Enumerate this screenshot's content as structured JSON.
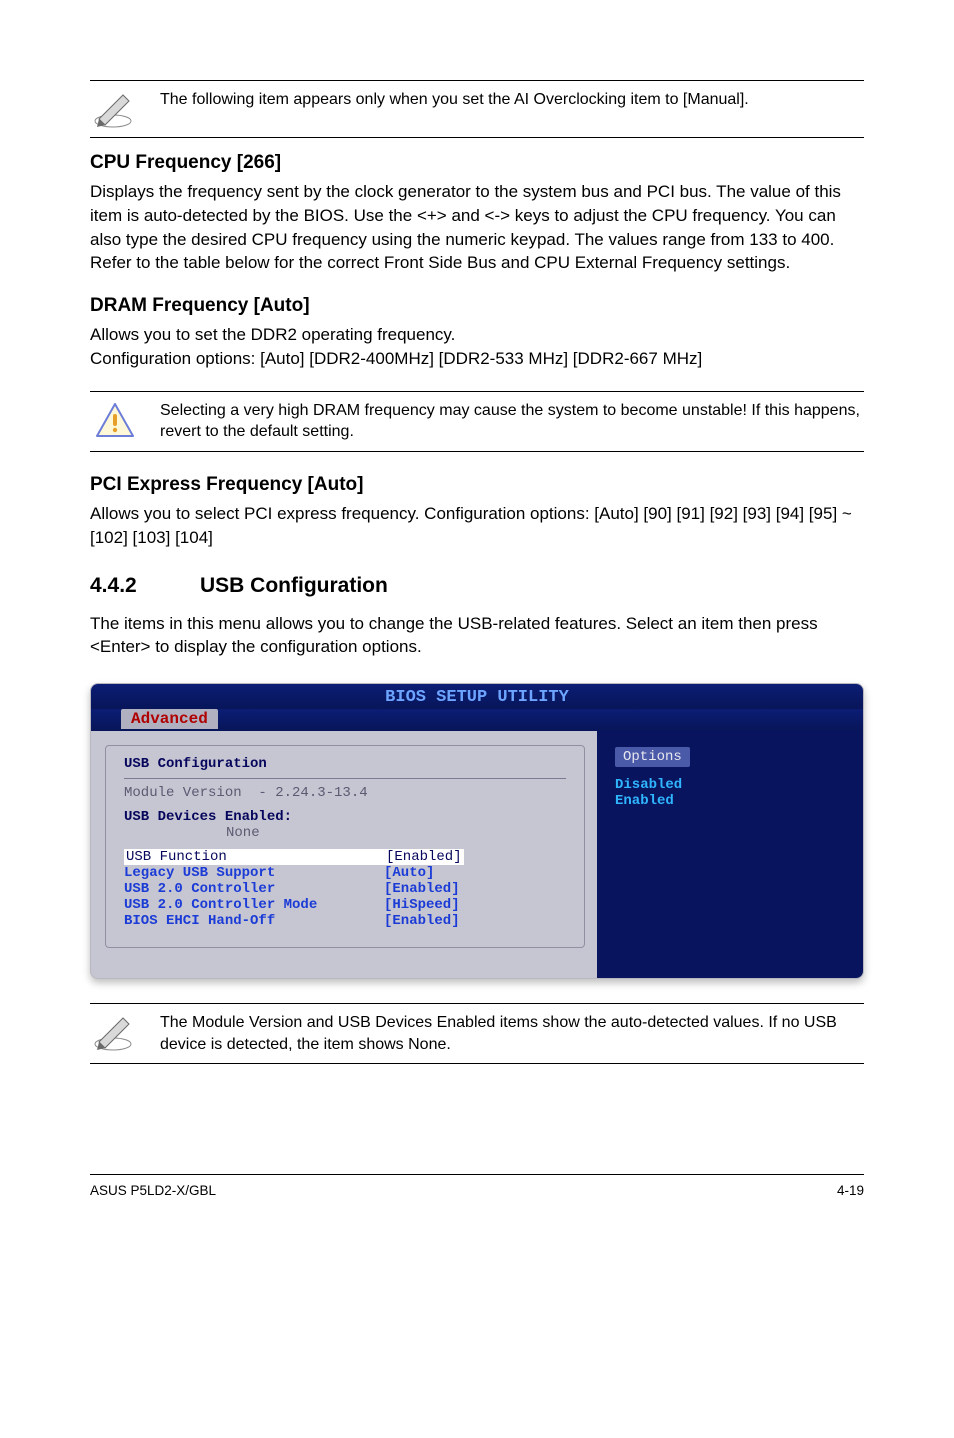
{
  "notes": {
    "top": "The following item appears only when you set the AI Overclocking item to [Manual].",
    "mid": "Selecting a very high DRAM frequency may cause the system to become unstable! If this happens, revert to the default setting.",
    "bottom": "The Module Version and USB Devices Enabled items show the auto-detected values. If no USB device is detected, the item shows None."
  },
  "cpu": {
    "heading": "CPU Frequency [266]",
    "body": "Displays the frequency sent by the clock generator to the system bus and PCI bus. The value of this item is auto-detected by the BIOS. Use the <+> and <-> keys to adjust the CPU frequency. You can also type the desired CPU frequency using the numeric keypad. The values range from 133 to 400. Refer to the table below for the correct Front Side Bus and CPU External Frequency settings."
  },
  "dram": {
    "heading": "DRAM Frequency [Auto]",
    "body": "Allows you to set the DDR2 operating frequency.\nConfiguration options: [Auto] [DDR2-400MHz] [DDR2-533 MHz] [DDR2-667 MHz]"
  },
  "pcie": {
    "heading": "PCI Express Frequency [Auto]",
    "body": "Allows you to select PCI express frequency. Configuration options: [Auto] [90] [91] [92] [93] [94] [95] ~ [102] [103] [104]"
  },
  "section": {
    "num": "4.4.2",
    "title": "USB Configuration",
    "body": "The items in this menu allows you to change the USB-related features. Select an item then press <Enter> to display the configuration options."
  },
  "bios": {
    "title": "BIOS SETUP UTILITY",
    "tab": "Advanced",
    "panel_title": "USB Configuration",
    "module_line": "Module Version  - 2.24.3-13.4",
    "devices_label": "USB Devices Enabled:",
    "devices_value": "None",
    "rows": [
      {
        "label": "USB Function",
        "value": "[Enabled]",
        "sel": true
      },
      {
        "label": "Legacy USB Support",
        "value": "[Auto]"
      },
      {
        "label": "USB 2.0 Controller",
        "value": "[Enabled]"
      },
      {
        "label": "USB 2.0 Controller Mode",
        "value": "[HiSpeed]"
      },
      {
        "label": "BIOS EHCI Hand-Off",
        "value": "[Enabled]"
      }
    ],
    "right": {
      "title": "Options",
      "items": [
        "Disabled",
        "Enabled"
      ]
    }
  },
  "footer": {
    "left": "ASUS P5LD2-X/GBL",
    "right": "4-19"
  }
}
